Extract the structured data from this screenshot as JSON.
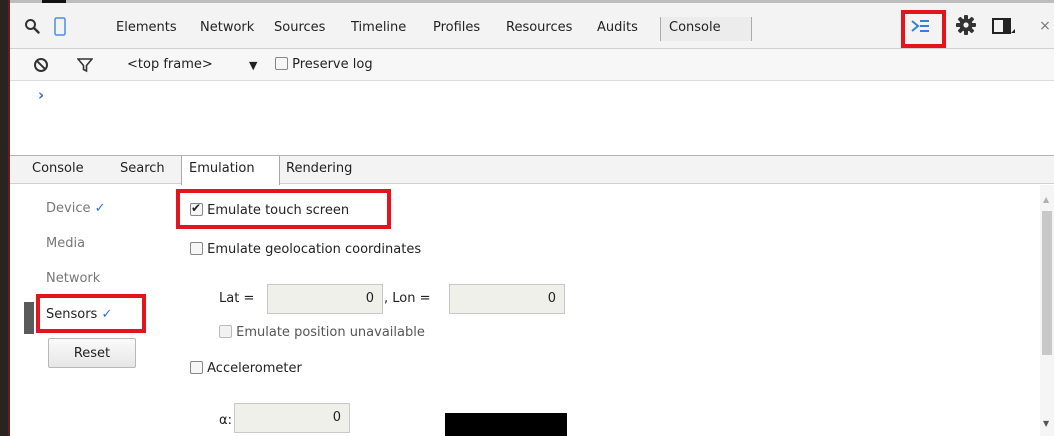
{
  "toolbar": {
    "tabs": [
      "Elements",
      "Network",
      "Sources",
      "Timeline",
      "Profiles",
      "Resources",
      "Audits",
      "Console"
    ],
    "active_tab": "Console",
    "close_glyph": "×",
    "icons": [
      "search-icon",
      "device-mode-icon",
      "show-drawer-icon",
      "settings-gear-icon",
      "dock-side-icon",
      "close-icon"
    ]
  },
  "console_bar": {
    "frame_select": "<top frame>",
    "frame_arrow": "▼",
    "preserve_log_label": "Preserve log",
    "preserve_log_checked": false,
    "icons": [
      "clear-console-icon",
      "filter-icon"
    ]
  },
  "console": {
    "prompt": "›"
  },
  "drawer": {
    "tabs": [
      "Console",
      "Search",
      "Emulation",
      "Rendering"
    ],
    "active_tab": "Emulation"
  },
  "emulation": {
    "sidebar": {
      "items": [
        {
          "label": "Device",
          "check": "✓"
        },
        {
          "label": "Media",
          "check": ""
        },
        {
          "label": "Network",
          "check": ""
        },
        {
          "label": "Sensors",
          "check": "✓"
        }
      ],
      "reset_label": "Reset"
    },
    "sensors": {
      "emulate_touch_label": "Emulate touch screen",
      "emulate_touch_checked": true,
      "geolocation_label": "Emulate geolocation coordinates",
      "geolocation_checked": false,
      "lat_label": "Lat =",
      "lat_value": "0",
      "lon_label": ", Lon =",
      "lon_value": "0",
      "position_unavailable_label": "Emulate position unavailable",
      "position_unavailable_checked": false,
      "accelerometer_label": "Accelerometer",
      "accelerometer_checked": false,
      "alpha_label": "α:",
      "alpha_value": "0"
    }
  },
  "colors": {
    "highlight_box": "#e3141b",
    "accent_blue": "#2e6fd8"
  }
}
